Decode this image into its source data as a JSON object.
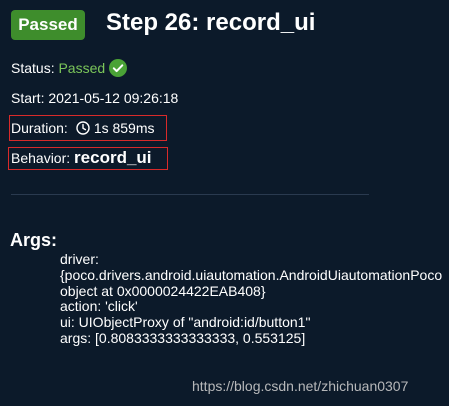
{
  "header": {
    "badge": "Passed",
    "title": "Step 26: record_ui"
  },
  "status": {
    "label": "Status: ",
    "value": "Passed"
  },
  "start": {
    "text": "Start: 2021-05-12 09:26:18"
  },
  "duration": {
    "label": "Duration:",
    "value": "1s 859ms"
  },
  "behavior": {
    "label": "Behavior: ",
    "value": "record_ui"
  },
  "args": {
    "heading": "Args:",
    "lines": [
      "driver:",
      "{poco.drivers.android.uiautomation.AndroidUiautomationPoco",
      "object at 0x0000024422EAB408}",
      "action: 'click'",
      "ui: UIObjectProxy of \"android:id/button1\"",
      "args: [0.8083333333333333, 0.553125]"
    ]
  },
  "watermark": "https://blog.csdn.net/zhichuan0307",
  "colors": {
    "background": "#0c1a2a",
    "badge": "#3e8d2c",
    "passed_text": "#7bc65a",
    "highlight_border": "#d82a2a"
  },
  "icons": {
    "status": "check-circle-icon",
    "duration": "clock-icon"
  }
}
